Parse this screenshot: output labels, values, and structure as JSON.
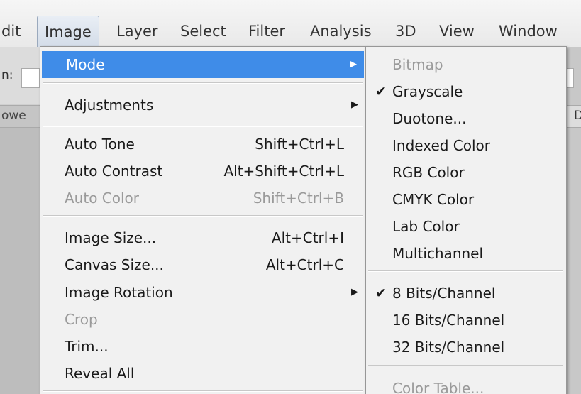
{
  "menubar": {
    "items": [
      {
        "label": "dit"
      },
      {
        "label": "Image"
      },
      {
        "label": "Layer"
      },
      {
        "label": "Select"
      },
      {
        "label": "Filter"
      },
      {
        "label": "Analysis"
      },
      {
        "label": "3D"
      },
      {
        "label": "View"
      },
      {
        "label": "Window"
      }
    ],
    "active": "Image"
  },
  "options_bar": {
    "label": "n:"
  },
  "panel_tab": {
    "label": "owe"
  },
  "right_tab": {
    "label": "D"
  },
  "image_menu": {
    "items": [
      {
        "label": "Mode",
        "submenu_arrow": "▶",
        "state": "highlighted"
      },
      {
        "label": "Adjustments",
        "submenu_arrow": "▶"
      },
      {
        "label": "Auto Tone",
        "shortcut": "Shift+Ctrl+L"
      },
      {
        "label": "Auto Contrast",
        "shortcut": "Alt+Shift+Ctrl+L"
      },
      {
        "label": "Auto Color",
        "shortcut": "Shift+Ctrl+B",
        "state": "disabled"
      },
      {
        "label": "Image Size...",
        "shortcut": "Alt+Ctrl+I"
      },
      {
        "label": "Canvas Size...",
        "shortcut": "Alt+Ctrl+C"
      },
      {
        "label": "Image Rotation",
        "submenu_arrow": "▶"
      },
      {
        "label": "Crop",
        "state": "disabled"
      },
      {
        "label": "Trim..."
      },
      {
        "label": "Reveal All"
      }
    ]
  },
  "mode_submenu": {
    "check_glyph": "✔",
    "items": [
      {
        "label": "Bitmap",
        "state": "disabled"
      },
      {
        "label": "Grayscale",
        "checked": true
      },
      {
        "label": "Duotone..."
      },
      {
        "label": "Indexed Color"
      },
      {
        "label": "RGB Color"
      },
      {
        "label": "CMYK Color"
      },
      {
        "label": "Lab Color"
      },
      {
        "label": "Multichannel"
      },
      {
        "label": "8 Bits/Channel",
        "checked": true
      },
      {
        "label": "16 Bits/Channel"
      },
      {
        "label": "32 Bits/Channel"
      },
      {
        "label": "Color Table...",
        "state": "disabled"
      }
    ]
  },
  "colors": {
    "highlight": "#3f8ce8",
    "disabled_text": "#9a9a9a",
    "menu_bg": "#f1f1f1"
  }
}
